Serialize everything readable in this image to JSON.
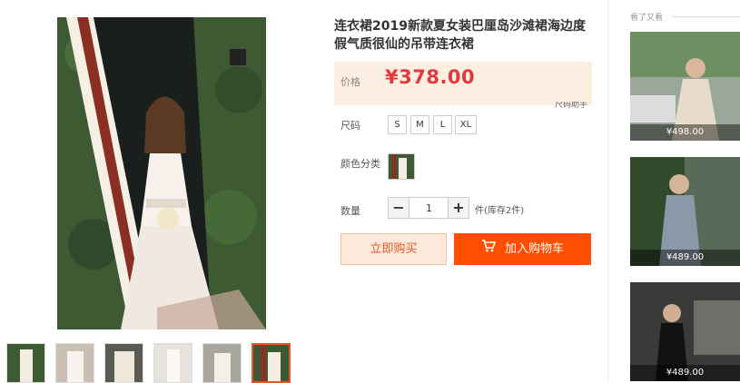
{
  "product": {
    "title": "连衣裙2019新款夏女装巴厘岛沙滩裙海边度假气质很仙的吊带连衣裙",
    "price_label": "价格",
    "price": "¥378.00",
    "size_guide": "尺码助手"
  },
  "size": {
    "label": "尺码",
    "options": [
      "S",
      "M",
      "L",
      "XL"
    ]
  },
  "color": {
    "label": "颜色分类"
  },
  "quantity": {
    "label": "数量",
    "value": "1",
    "minus": "−",
    "plus": "+",
    "stock_text": "件(库存2件)"
  },
  "actions": {
    "buy_now": "立即购买",
    "add_to_cart": "加入购物车"
  },
  "recommend": {
    "heading": "看了又看",
    "items": [
      {
        "price": "¥498.00"
      },
      {
        "price": "¥489.00"
      },
      {
        "price": "¥489.00"
      }
    ]
  },
  "icons": [
    "cart-icon"
  ],
  "colors": {
    "accent": "#ff4e00",
    "price_red": "#e4393c",
    "price_bg": "#fdeee2",
    "buy_now_bg": "#fde9d9"
  }
}
